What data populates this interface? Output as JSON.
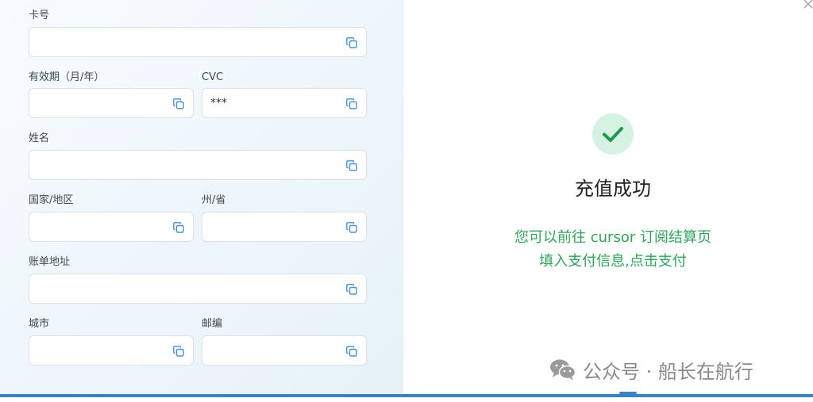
{
  "form": {
    "card_number": {
      "label": "卡号",
      "value": ""
    },
    "expiry": {
      "label": "有效期（月/年）",
      "value": ""
    },
    "cvc": {
      "label": "CVC",
      "value": "***"
    },
    "name": {
      "label": "姓名",
      "value": ""
    },
    "country": {
      "label": "国家/地区",
      "value": ""
    },
    "state": {
      "label": "州/省",
      "value": ""
    },
    "billing_address": {
      "label": "账单地址",
      "value": ""
    },
    "city": {
      "label": "城市",
      "value": ""
    },
    "postal_code": {
      "label": "邮编",
      "value": ""
    }
  },
  "success": {
    "title": "充值成功",
    "message_line1": "您可以前往 cursor 订阅结算页",
    "message_line2": "填入支付信息,点击支付"
  },
  "watermark": {
    "text": "公众号 · 船长在航行"
  },
  "icons": {
    "copy": "copy-icon",
    "close": "close-icon",
    "check": "check-icon",
    "wechat": "wechat-icon"
  },
  "colors": {
    "accent": "#3a82c8",
    "success_green": "#2fa45a",
    "success_badge_bg": "#d6f2e2",
    "copy_icon": "#4a8fd6"
  }
}
